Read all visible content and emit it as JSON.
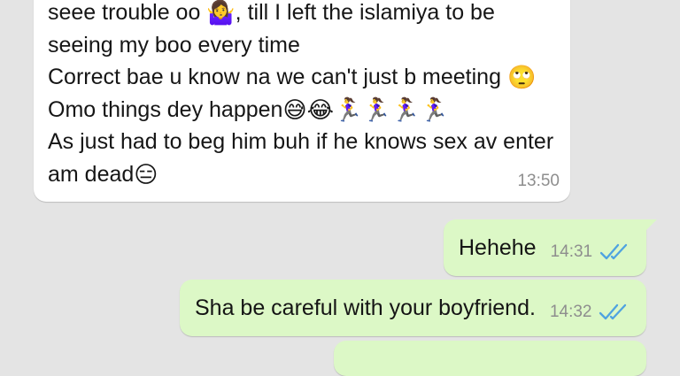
{
  "colors": {
    "background": "#e4e4e4",
    "incoming_bubble": "#ffffff",
    "outgoing_bubble": "#dcf8c6",
    "read_ticks": "#4fa3e0",
    "timestamp": "#8e8e8e"
  },
  "incoming_message": {
    "lines": [
      {
        "before": "seee trouble oo ",
        "emoji": "🤷‍♀️",
        "emoji_icon": "person-shrugging-emoji",
        "after": ", till I left the islamiya to be"
      },
      {
        "text": "seeing my boo every time"
      },
      {
        "before": "Correct bae u know na we can't just b meeting ",
        "emoji": "🙄",
        "emoji_icon": "face-rolling-eyes-emoji"
      },
      {
        "before": "Omo things dey happen",
        "emoji": "😅😂🏃‍♀️🏃‍♀️🏃‍♀️🏃‍♀️",
        "emoji_icon": "laughing-running-woman-emojis"
      },
      {
        "text": "As just had to beg him buh if he knows sex av enter"
      },
      {
        "before": "am dead",
        "emoji": "😑",
        "emoji_icon": "expressionless-face-emoji"
      }
    ],
    "time": "13:50"
  },
  "outgoing_messages": [
    {
      "text": "Hehehe",
      "time": "14:31",
      "status_icon": "double-check-read-icon"
    },
    {
      "text": "Sha be careful with your boyfriend.",
      "time": "14:32",
      "status_icon": "double-check-read-icon"
    },
    {
      "text": "",
      "time": ""
    }
  ]
}
